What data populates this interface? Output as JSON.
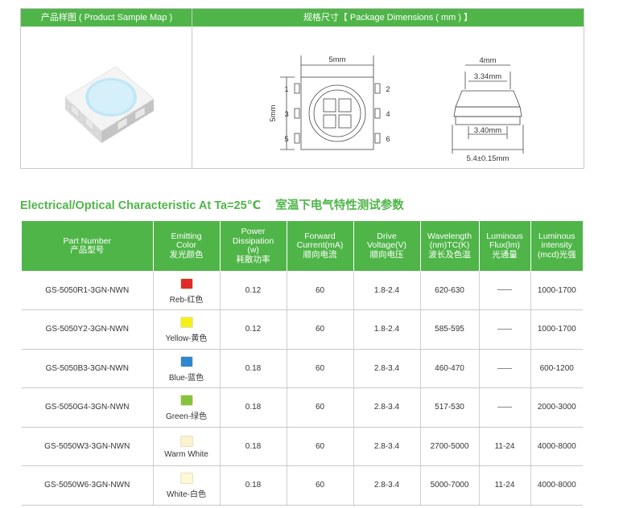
{
  "top": {
    "sample_header": "产品样图 ( Product Sample Map )",
    "dimensions_header": "规格尺寸【 Package Dimensions ( mm ) 】",
    "drawing": {
      "width_label": "5mm",
      "height_label": "5mm",
      "pins": [
        "1",
        "2",
        "3",
        "4",
        "5",
        "6"
      ],
      "side_top": "4mm",
      "side_inner_top": "3.34mm",
      "side_inner_bottom": "3.40mm",
      "side_bottom": "5.4±0.15mm"
    }
  },
  "section_title": {
    "en": "Electrical/Optical Characteristic At Ta=25℃",
    "cn": "室温下电气特性测试参数"
  },
  "table": {
    "headers": [
      [
        "Part Number",
        "产品型号"
      ],
      [
        "Emitting",
        "Color",
        "发光颜色"
      ],
      [
        "Power",
        "Dissipation",
        "(w)",
        "耗散功率"
      ],
      [
        "Forward",
        "Current(mA)",
        "顺向电流"
      ],
      [
        "Drive",
        "Voltage(V)",
        "顺向电压"
      ],
      [
        "Wavelength",
        "(nm)TC(K)",
        "波长及色温"
      ],
      [
        "Luminous",
        "Flux(lm)",
        "光通量"
      ],
      [
        "Luminous",
        "intensity",
        "(mcd)光强"
      ]
    ],
    "rows": [
      {
        "part": "GS-5050R1-3GN-NWN",
        "swatch": "#e02b2b",
        "color": "Reb-红色",
        "power": "0.12",
        "current": "60",
        "voltage": "1.8-2.4",
        "wavelength": "620-630",
        "flux": "",
        "intensity": "1000-1700"
      },
      {
        "part": "GS-5050Y2-3GN-NWN",
        "swatch": "#f4ef1a",
        "color": "Yellow-黄色",
        "power": "0.12",
        "current": "60",
        "voltage": "1.8-2.4",
        "wavelength": "585-595",
        "flux": "",
        "intensity": "1000-1700"
      },
      {
        "part": "GS-5050B3-3GN-NWN",
        "swatch": "#2f86d3",
        "color": "Blue-蓝色",
        "power": "0.18",
        "current": "60",
        "voltage": "2.8-3.4",
        "wavelength": "460-470",
        "flux": "",
        "intensity": "600-1200"
      },
      {
        "part": "GS-5050G4-3GN-NWN",
        "swatch": "#86c440",
        "color": "Green-绿色",
        "power": "0.18",
        "current": "60",
        "voltage": "2.8-3.4",
        "wavelength": "517-530",
        "flux": "",
        "intensity": "2000-3000"
      },
      {
        "part": "GS-5050W3-3GN-NWN",
        "swatch": "#fbf3cf",
        "color": "Warm White",
        "power": "0.18",
        "current": "60",
        "voltage": "2.8-3.4",
        "wavelength": "2700-5000",
        "flux": "11-24",
        "intensity": "4000-8000"
      },
      {
        "part": "GS-5050W6-3GN-NWN",
        "swatch": "#fdf8d6",
        "color": "White-白色",
        "power": "0.18",
        "current": "60",
        "voltage": "2.8-3.4",
        "wavelength": "5000-7000",
        "flux": "11-24",
        "intensity": "4000-8000"
      }
    ]
  }
}
